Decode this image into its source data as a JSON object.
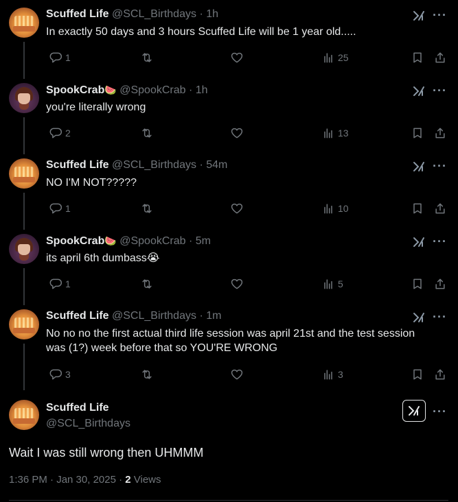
{
  "tweets": [
    {
      "name": "Scuffed Life",
      "emoji": "",
      "handle": "@SCL_Birthdays",
      "time": "· 1h",
      "text": "In exactly 50 days and 3 hours Scuffed Life will be 1 year old.....",
      "replies": "1",
      "retweets": "",
      "likes": "",
      "views": "25",
      "avatar": "scl"
    },
    {
      "name": "SpookCrab",
      "emoji": "🍉",
      "handle": "@SpookCrab",
      "time": "· 1h",
      "text": "you're literally wrong",
      "replies": "2",
      "retweets": "",
      "likes": "",
      "views": "13",
      "avatar": "spook"
    },
    {
      "name": "Scuffed Life",
      "emoji": "",
      "handle": "@SCL_Birthdays",
      "time": "· 54m",
      "text": "NO I'M NOT?????",
      "replies": "1",
      "retweets": "",
      "likes": "",
      "views": "10",
      "avatar": "scl"
    },
    {
      "name": "SpookCrab",
      "emoji": "🍉",
      "handle": "@SpookCrab",
      "time": "· 5m",
      "text": "its april 6th dumbass😭",
      "replies": "1",
      "retweets": "",
      "likes": "",
      "views": "5",
      "avatar": "spook"
    },
    {
      "name": "Scuffed Life",
      "emoji": "",
      "handle": "@SCL_Birthdays",
      "time": "· 1m",
      "text": "No no no the first actual third life session was april 21st and the test session was (1?) week before that so YOU'RE WRONG",
      "replies": "3",
      "retweets": "",
      "likes": "",
      "views": "3",
      "avatar": "scl"
    }
  ],
  "final": {
    "name": "Scuffed Life",
    "handle": "@SCL_Birthdays",
    "text": "Wait I was still wrong then UHMMM",
    "timestamp": "1:36 PM · Jan 30, 2025 · ",
    "views_count": "2",
    "views_label": " Views"
  },
  "icons": {
    "reply": "reply-icon",
    "retweet": "retweet-icon",
    "like": "heart-icon",
    "views": "views-icon",
    "bookmark": "bookmark-icon",
    "share": "share-icon",
    "grok": "grok-icon",
    "more": "more-icon"
  },
  "colors": {
    "background": "#000000",
    "text": "#e7e9ea",
    "secondary": "#71767b",
    "line": "#333639"
  }
}
